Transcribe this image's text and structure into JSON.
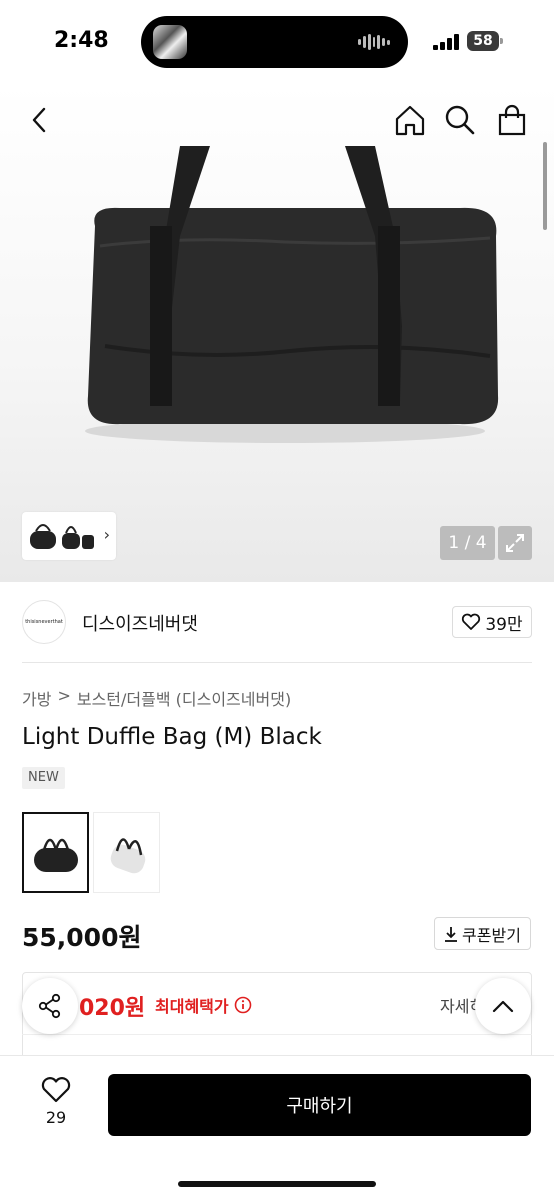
{
  "status_bar": {
    "time": "2:48",
    "battery": "58"
  },
  "header": {
    "back_icon": "chevron-left-icon",
    "home_icon": "home-icon",
    "search_icon": "search-icon",
    "cart_icon": "shopping-bag-icon"
  },
  "gallery": {
    "counter": "1 / 4",
    "current": 1,
    "total": 4
  },
  "shop": {
    "logo_text": "thisisneverthat",
    "name": "디스이즈네버댓",
    "likes": "39만"
  },
  "breadcrumb": {
    "category": "가방",
    "separator": ">",
    "subcategory": "보스턴/더플백 (디스이즈네버댓)"
  },
  "product": {
    "title": "Light Duffle Bag (M) Black",
    "badge": "NEW",
    "variants": [
      {
        "color": "black",
        "selected": true
      },
      {
        "color": "white",
        "selected": false
      }
    ],
    "price": "55,000원",
    "coupon_label": "쿠폰받기"
  },
  "benefit": {
    "price_partial": "020원",
    "label": "최대혜택가",
    "detail_partial": "자세히"
  },
  "bottom_bar": {
    "wish_count": "29",
    "buy_label": "구매하기"
  },
  "colors": {
    "accent_red": "#e02020",
    "buy_button": "#000000"
  }
}
